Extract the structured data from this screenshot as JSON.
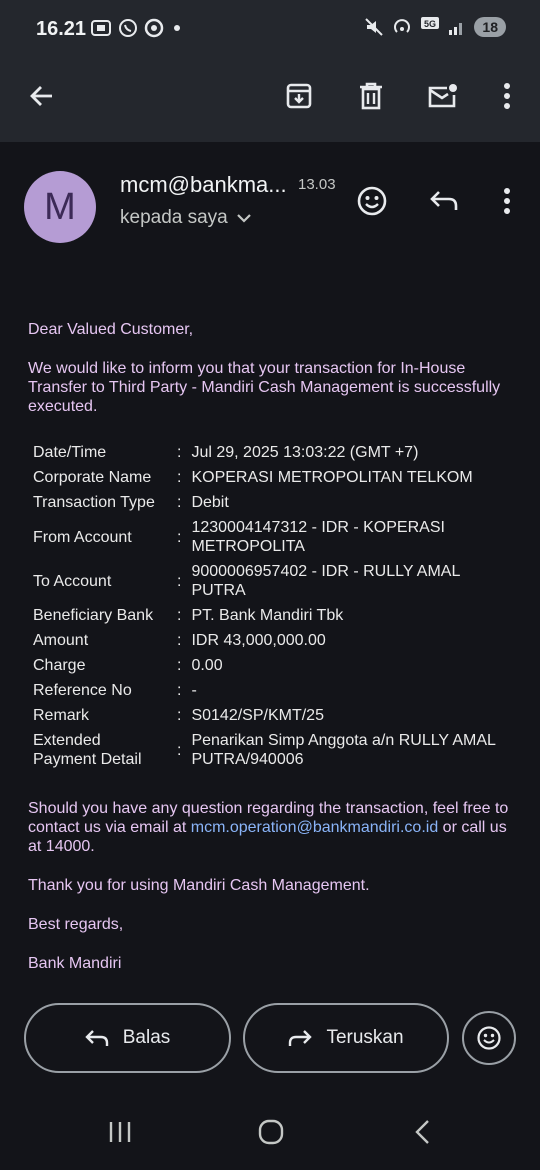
{
  "status_bar": {
    "time": "16.21",
    "battery": "18"
  },
  "sender": {
    "avatar_letter": "M",
    "name": "mcm@bankma...",
    "time": "13.03",
    "recipient": "kepada saya"
  },
  "email": {
    "greeting": "Dear Valued Customer,",
    "intro": "We would like to inform you that your transaction for In-House Transfer to Third Party - Mandiri Cash Management is successfully executed.",
    "colon": ":",
    "details": [
      {
        "label": "Date/Time",
        "value": "Jul 29, 2025 13:03:22 (GMT +7)"
      },
      {
        "label": "Corporate Name",
        "value": "KOPERASI METROPOLITAN TELKOM"
      },
      {
        "label": "Transaction Type",
        "value": "Debit"
      },
      {
        "label": "From Account",
        "value": "1230004147312 - IDR - KOPERASI METROPOLITA"
      },
      {
        "label": "To Account",
        "value": "9000006957402 - IDR - RULLY AMAL PUTRA"
      },
      {
        "label": "Beneficiary Bank",
        "value": "PT. Bank Mandiri Tbk"
      },
      {
        "label": "Amount",
        "value": "IDR 43,000,000.00"
      },
      {
        "label": "Charge",
        "value": "0.00"
      },
      {
        "label": "Reference No",
        "value": "-"
      },
      {
        "label": "Remark",
        "value": "S0142/SP/KMT/25"
      },
      {
        "label": "Extended Payment Detail",
        "value": "Penarikan Simp Anggota a/n RULLY AMAL PUTRA/940006"
      }
    ],
    "question_before": "Should you have any question regarding the transaction, feel free to contact us via email at ",
    "contact_email": "mcm.operation@bankmandiri.co.id",
    "question_after": " or call us at 14000.",
    "thanks": "Thank you for using Mandiri Cash Management.",
    "regards": "Best regards,",
    "signature": "Bank Mandiri"
  },
  "actions": {
    "reply": "Balas",
    "forward": "Teruskan"
  },
  "colors": {
    "accent_text": "#e6c6f2",
    "link": "#8ab4f8",
    "avatar": "#b59cd4",
    "bar_bg": "#24272d",
    "bg": "#131419"
  },
  "icons": [
    "back-arrow-icon",
    "archive-icon",
    "delete-icon",
    "mark-unread-icon",
    "more-vert-icon",
    "emoji-icon",
    "reply-icon",
    "forward-icon",
    "chevron-down-icon"
  ]
}
